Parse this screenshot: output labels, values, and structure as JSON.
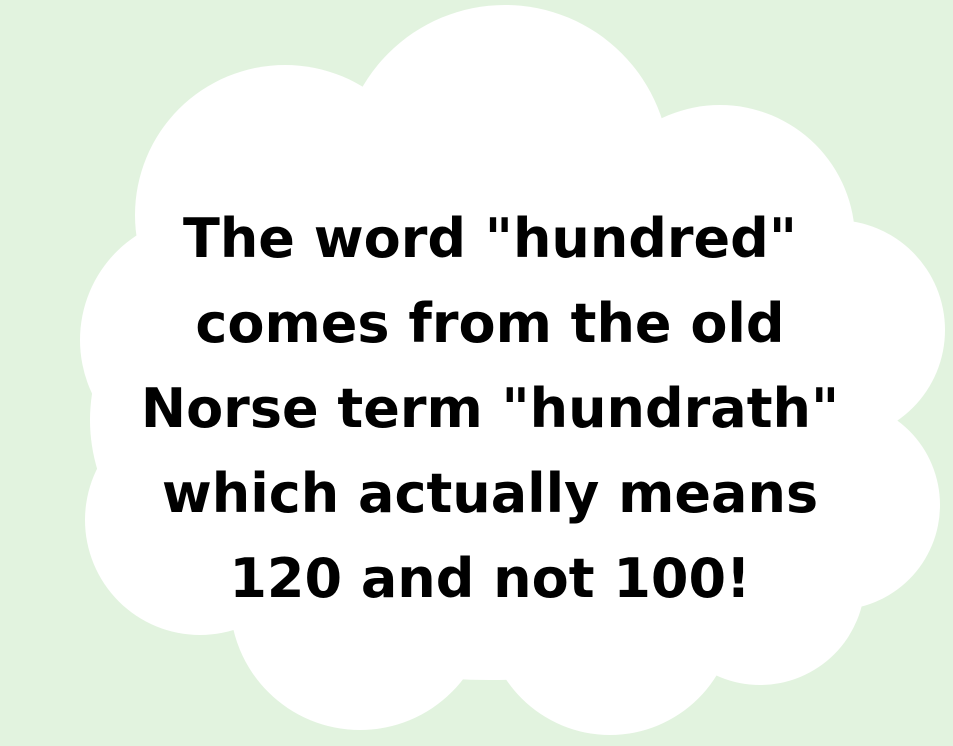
{
  "colors": {
    "background": "#e2f3df",
    "cloud": "#ffffff",
    "text": "#000000"
  },
  "fact": {
    "lines": [
      "The word \"hundred\"",
      "comes from the old",
      "Norse term \"hundrath\"",
      "which actually means",
      "120 and not 100!"
    ]
  }
}
